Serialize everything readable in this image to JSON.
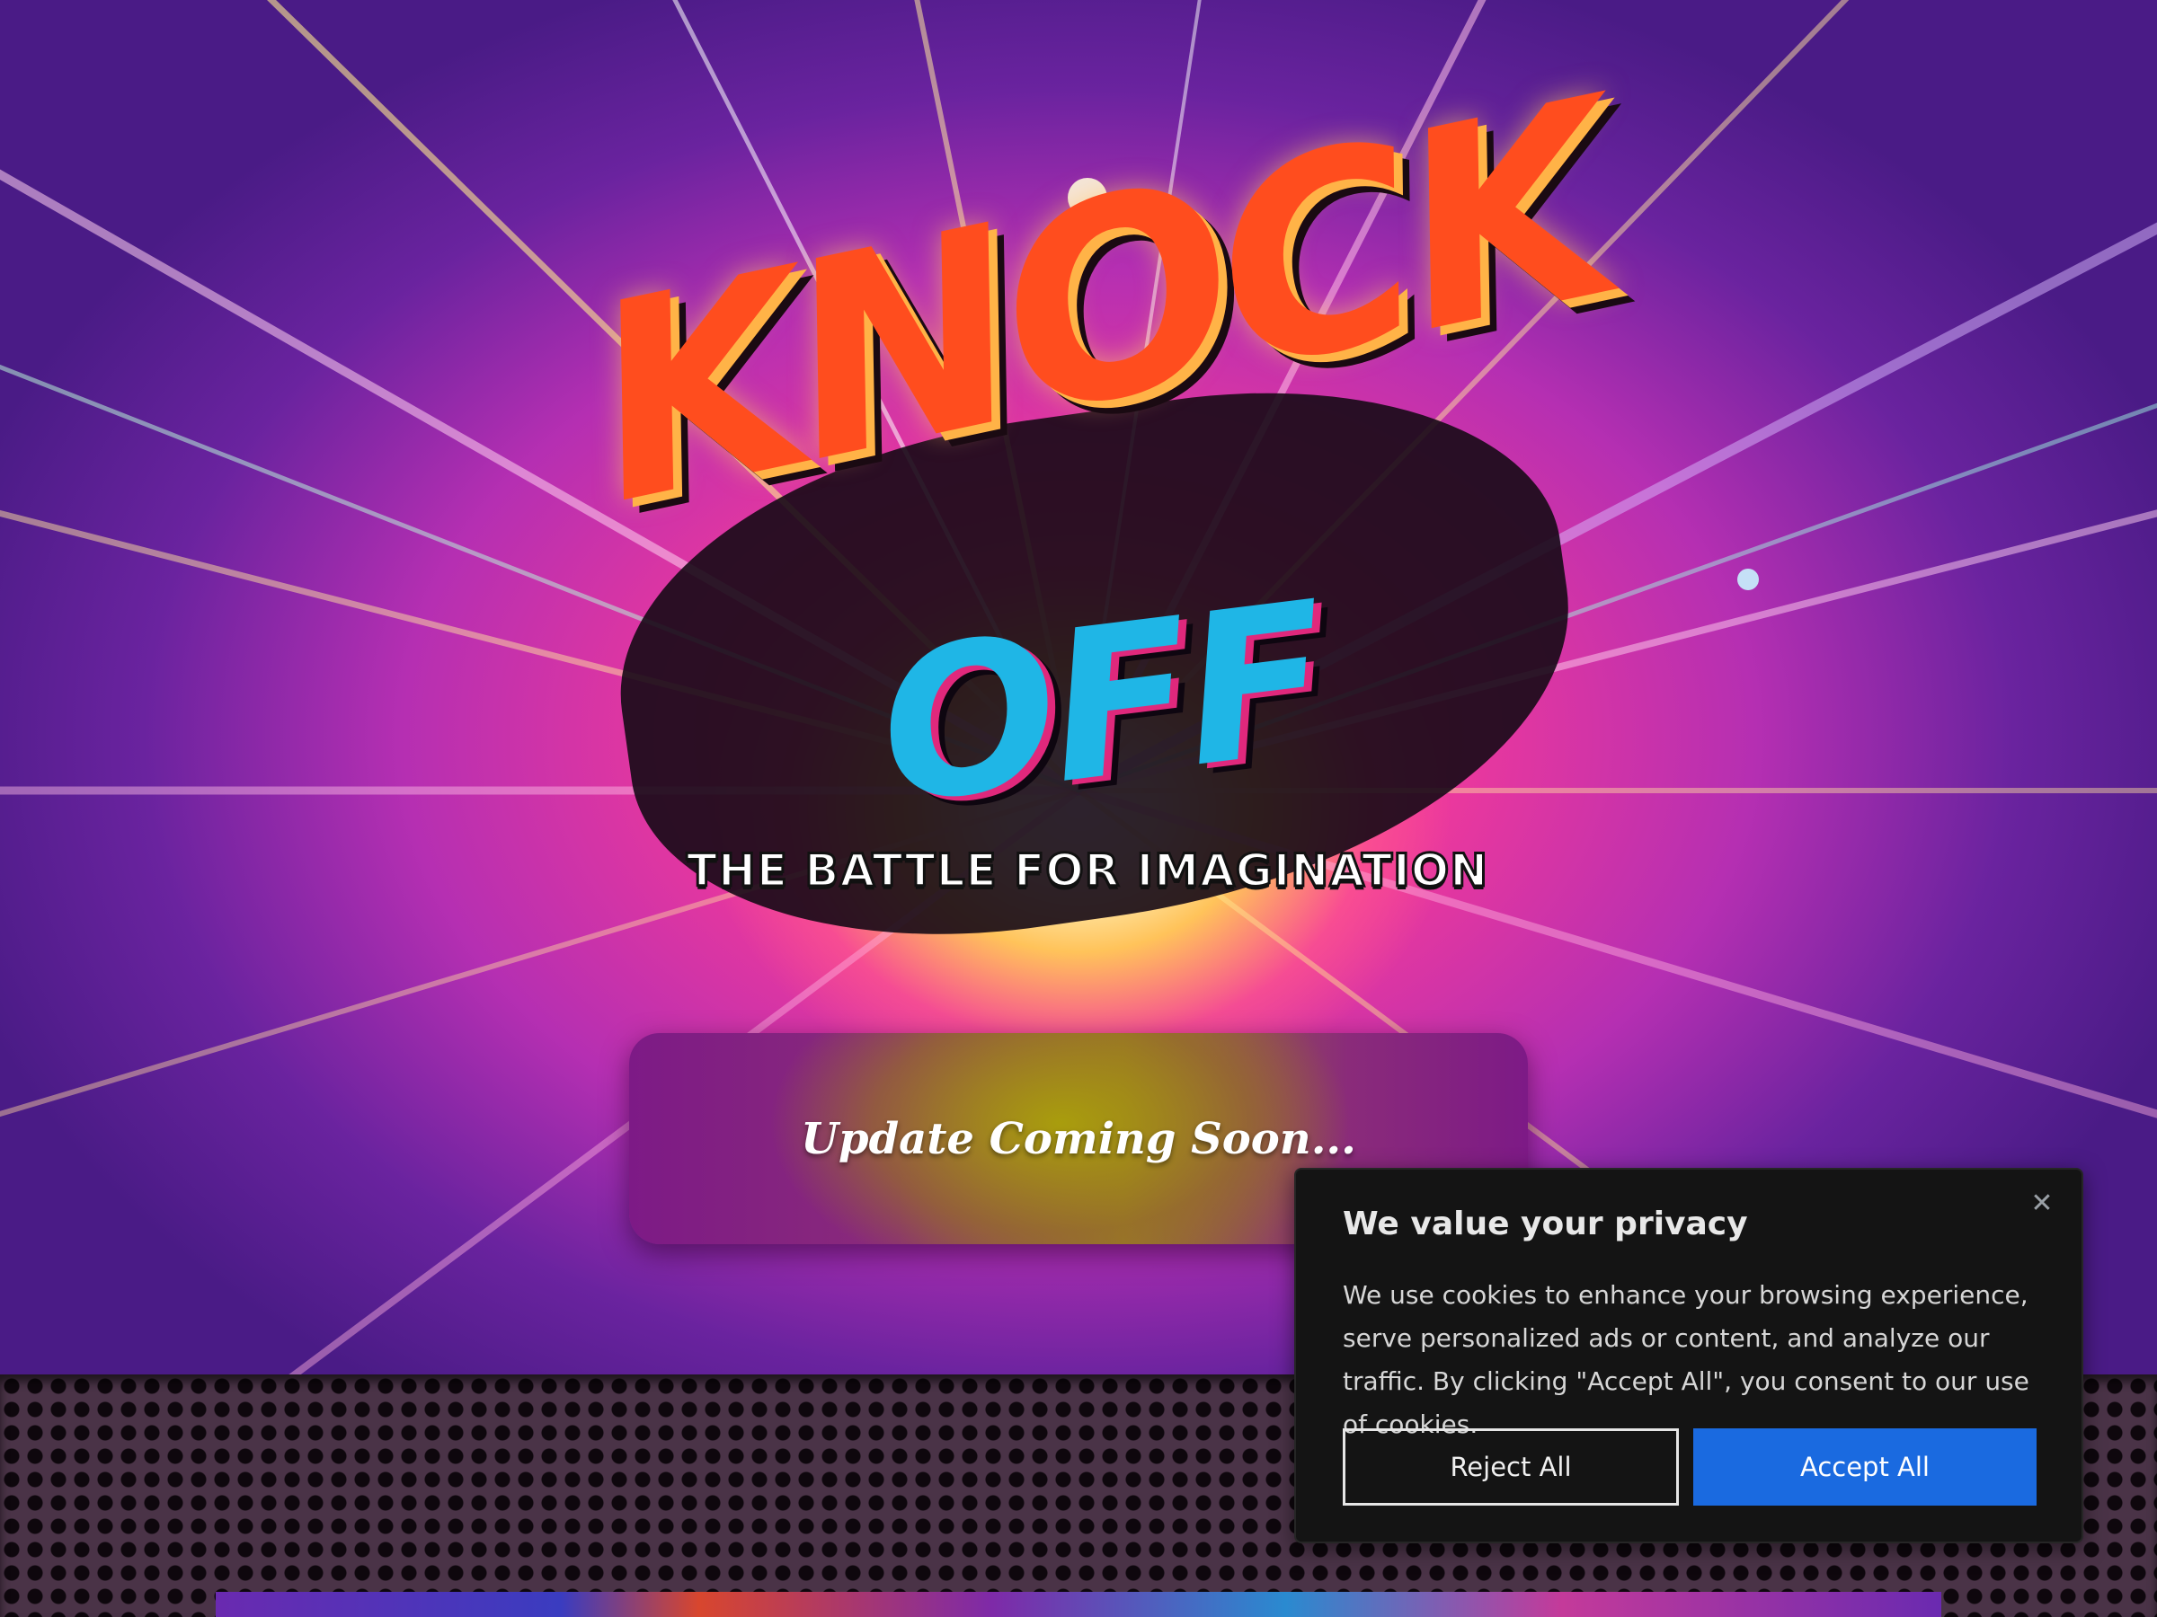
{
  "hero": {
    "logo": {
      "title_line1": "KNOCK",
      "title_line2": "OFF",
      "tagline": "THE BATTLE FOR IMAGINATION"
    },
    "update_text": "Update Coming Soon..."
  },
  "cookie_banner": {
    "title": "We value your privacy",
    "body": "We use cookies to enhance your browsing experience, serve personalized ads or content, and analyze our traffic. By clicking \"Accept All\", you consent to our use of cookies.",
    "reject_label": "Reject All",
    "accept_label": "Accept All",
    "close_icon": "close-icon"
  },
  "colors": {
    "accept_button": "#1a6ae0",
    "banner_background": "#141414",
    "logo_orange": "#ff4d1e",
    "logo_cyan": "#1fb6e6"
  }
}
